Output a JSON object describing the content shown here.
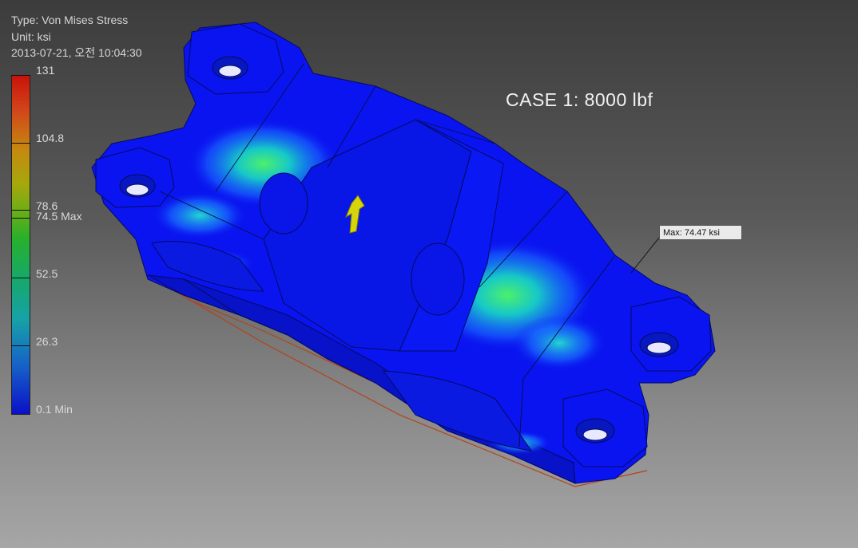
{
  "header": {
    "type_line": "Type: Von Mises Stress",
    "unit_line": "Unit: ksi",
    "timestamp": "2013-07-21, 오전 10:04:30"
  },
  "legend": {
    "ticks": [
      "131",
      "104.8",
      "78.6",
      "74.5 Max",
      "52.5",
      "26.3",
      "0.1 Min"
    ],
    "colors": {
      "max": "#c8120a",
      "high": "#c48a0f",
      "mid": "#28b02a",
      "low": "#16a2a6",
      "min": "#0a10c8"
    }
  },
  "case_label": "CASE 1: 8000 lbf",
  "probe": {
    "label": "Max: 74.47 ksi"
  },
  "model": {
    "icons": [
      "load-arrow-icon"
    ]
  }
}
